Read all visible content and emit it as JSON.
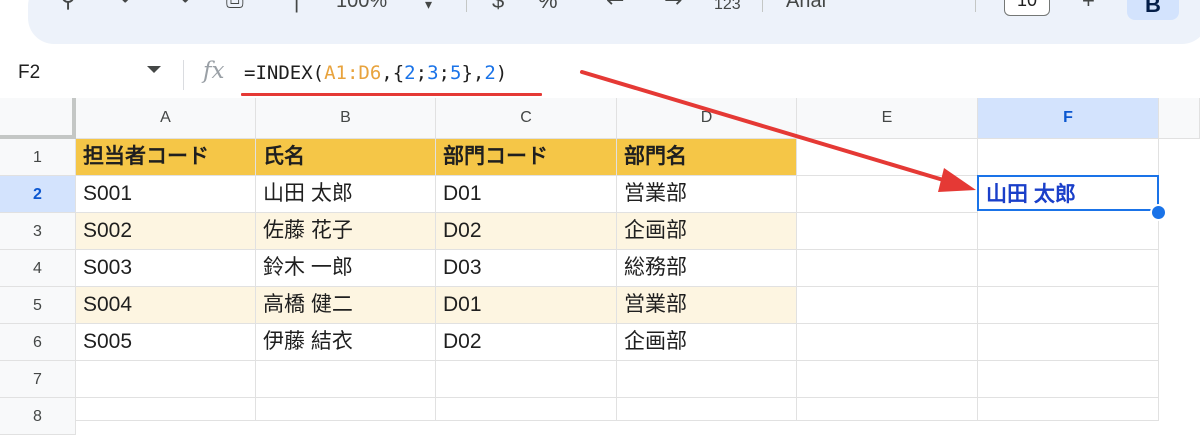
{
  "toolbar": {
    "zoom": "100%",
    "font_name": "Arial",
    "font_size": "10",
    "number_format": "123",
    "bold_label": "B"
  },
  "formula_bar": {
    "name_box": "F2",
    "fx_label": "fx",
    "formula_prefix": "=INDEX(",
    "formula_range": "A1:D6",
    "formula_open": ",{",
    "formula_n1": "2",
    "formula_s1": ";",
    "formula_n2": "3",
    "formula_s2": ";",
    "formula_n3": "5",
    "formula_close": "},",
    "formula_n4": "2",
    "formula_end": ")"
  },
  "columns": [
    "A",
    "B",
    "C",
    "D",
    "E",
    "F"
  ],
  "rows": [
    "1",
    "2",
    "3",
    "4",
    "5",
    "6",
    "7",
    "8"
  ],
  "table": {
    "header": [
      "担当者コード",
      "氏名",
      "部門コード",
      "部門名"
    ],
    "body": [
      [
        "S001",
        "山田 太郎",
        "D01",
        "営業部"
      ],
      [
        "S002",
        "佐藤 花子",
        "D02",
        "企画部"
      ],
      [
        "S003",
        "鈴木 一郎",
        "D03",
        "総務部"
      ],
      [
        "S004",
        "高橋 健二",
        "D01",
        "営業部"
      ],
      [
        "S005",
        "伊藤 結衣",
        "D02",
        "企画部"
      ]
    ]
  },
  "active_cell": {
    "ref": "F2",
    "value": "山田 太郎"
  },
  "colors": {
    "header_fill": "#f5c647",
    "band_fill": "#fdf5e1",
    "selection": "#1a73e8",
    "annotation": "#e53935"
  }
}
